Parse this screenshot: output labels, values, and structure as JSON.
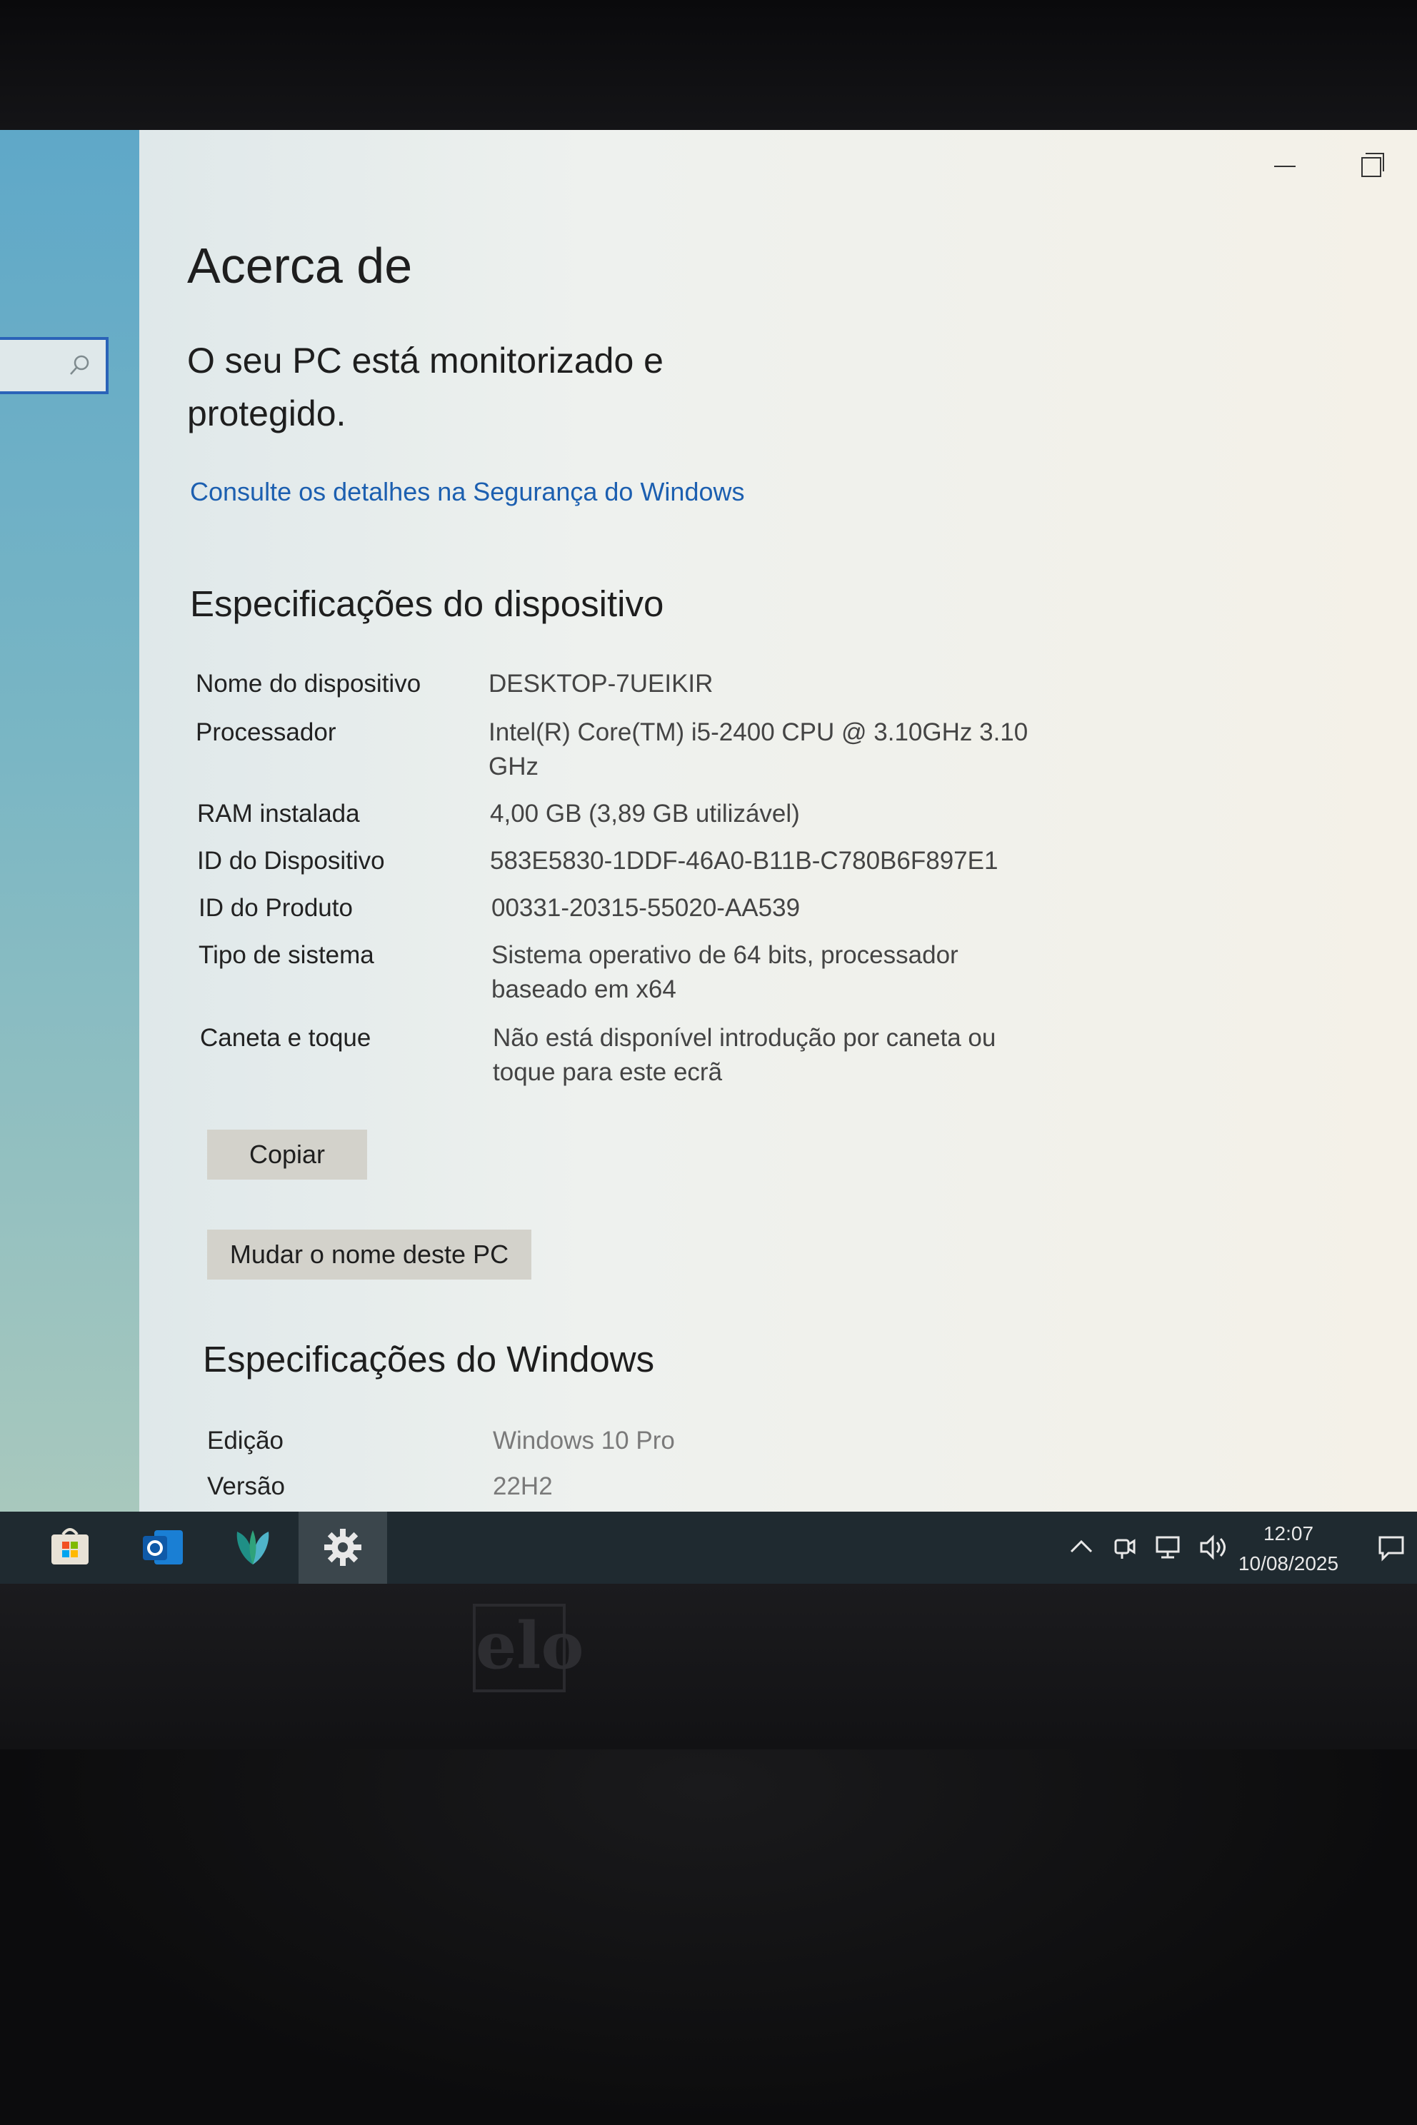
{
  "window": {
    "minimize_glyph": "",
    "restore_glyph": ""
  },
  "page": {
    "title": "Acerca de",
    "protection_status": "O seu PC está monitorizado e protegido.",
    "security_link": "Consulte os detalhes na Segurança do Windows"
  },
  "device_specs": {
    "title": "Especificações do dispositivo",
    "rows": [
      {
        "label": "Nome do dispositivo",
        "value": "DESKTOP-7UEIKIR"
      },
      {
        "label": "Processador",
        "value": "Intel(R) Core(TM) i5-2400 CPU @ 3.10GHz   3.10 GHz"
      },
      {
        "label": "RAM instalada",
        "value": "4,00 GB (3,89 GB utilizável)"
      },
      {
        "label": "ID do Dispositivo",
        "value": "583E5830-1DDF-46A0-B11B-C780B6F897E1"
      },
      {
        "label": "ID do Produto",
        "value": "00331-20315-55020-AA539"
      },
      {
        "label": "Tipo de sistema",
        "value": "Sistema operativo de 64 bits, processador baseado em x64"
      },
      {
        "label": "Caneta e toque",
        "value": "Não está disponível introdução por caneta ou toque para este ecrã"
      }
    ],
    "copy_button": "Copiar",
    "rename_button": "Mudar o nome deste PC"
  },
  "windows_specs": {
    "title": "Especificações do Windows",
    "rows": [
      {
        "label": "Edição",
        "value": "Windows 10 Pro"
      },
      {
        "label": "Versão",
        "value": "22H2"
      }
    ]
  },
  "taskbar": {
    "apps": [
      {
        "icon": "store-icon"
      },
      {
        "icon": "outlook-icon"
      },
      {
        "icon": "app-leaf-icon"
      },
      {
        "icon": "settings-gear-icon"
      }
    ],
    "tray": [
      "chevron-up-icon",
      "meet-now-icon",
      "network-icon",
      "volume-icon"
    ],
    "time": "12:07",
    "date": "10/08/2025"
  },
  "monitor": {
    "logo": "elo"
  },
  "colors": {
    "link": "#1c5fb0",
    "taskbar": "#1f2a30",
    "button": "#d3d2cb"
  }
}
